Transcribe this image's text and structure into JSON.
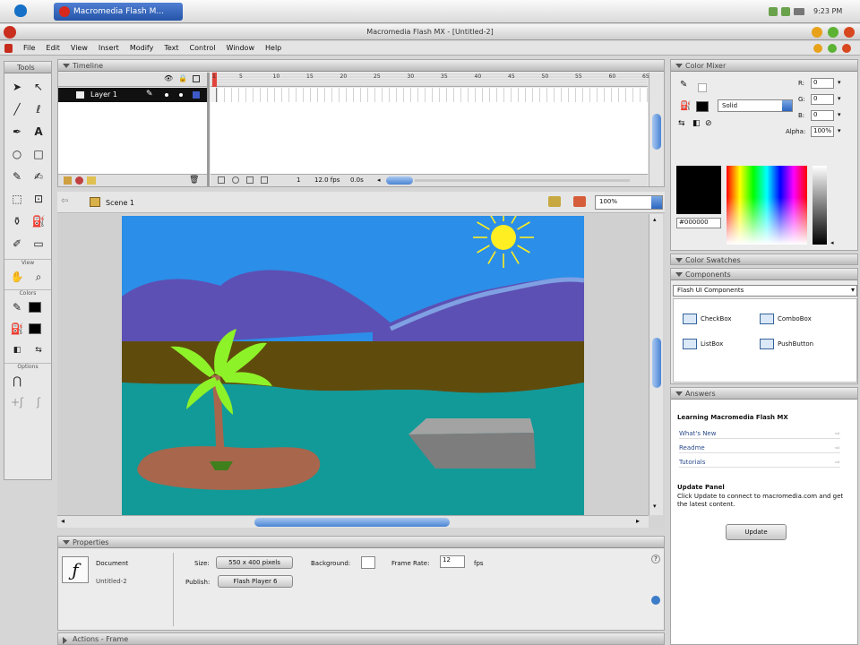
{
  "menubar": {
    "tab_title": "Macromedia Flash M...",
    "clock": "9:23 PM"
  },
  "window": {
    "title": "Macromedia Flash MX - [Untitled-2]",
    "menus": [
      "File",
      "Edit",
      "View",
      "Insert",
      "Modify",
      "Text",
      "Control",
      "Window",
      "Help"
    ]
  },
  "tools": {
    "title": "Tools",
    "view_label": "View",
    "colors_label": "Colors",
    "options_label": "Options"
  },
  "timeline": {
    "title": "Timeline",
    "layer_name": "Layer 1",
    "frame_ticks": [
      "1",
      "5",
      "10",
      "15",
      "20",
      "25",
      "30",
      "35",
      "40",
      "45",
      "50",
      "55",
      "60",
      "65"
    ],
    "current_frame": "1",
    "fps": "12.0 fps",
    "elapsed": "0.0s"
  },
  "scene": {
    "label": "Scene 1",
    "zoom": "100%"
  },
  "properties": {
    "title": "Properties",
    "doc_label": "Document",
    "doc_name": "Untitled-2",
    "size_label": "Size:",
    "size_value": "550 x 400 pixels",
    "background_label": "Background:",
    "framerate_label": "Frame Rate:",
    "framerate_value": "12",
    "fps_unit": "fps",
    "publish_label": "Publish:",
    "publish_value": "Flash Player 6"
  },
  "bottom_bar": {
    "actions": "Actions - Frame"
  },
  "color_mixer": {
    "title": "Color Mixer",
    "fill_type": "Solid",
    "r_label": "R:",
    "g_label": "G:",
    "b_label": "B:",
    "r": "0",
    "g": "0",
    "b": "0",
    "alpha_label": "Alpha:",
    "alpha": "100%",
    "hex": "#000000"
  },
  "color_swatches": {
    "title": "Color Swatches"
  },
  "components": {
    "title": "Components",
    "set": "Flash UI Components",
    "items": [
      "CheckBox",
      "ComboBox",
      "ListBox",
      "PushButton"
    ]
  },
  "answers": {
    "title": "Answers",
    "heading": "Learning Macromedia Flash MX",
    "links": [
      "What's New",
      "Readme",
      "Tutorials"
    ],
    "update_heading": "Update Panel",
    "update_text": "Click Update to connect to macromedia.com and get the latest content.",
    "update_button": "Update"
  },
  "colors": {
    "sky": "#2b8ee8",
    "mountain": "#5d50b4",
    "ground": "#5f4c0d",
    "water": "#129a98",
    "island": "#a8664d",
    "leaves": "#8ef228",
    "sun": "#ffee22",
    "boat": "#7d7d7d"
  }
}
